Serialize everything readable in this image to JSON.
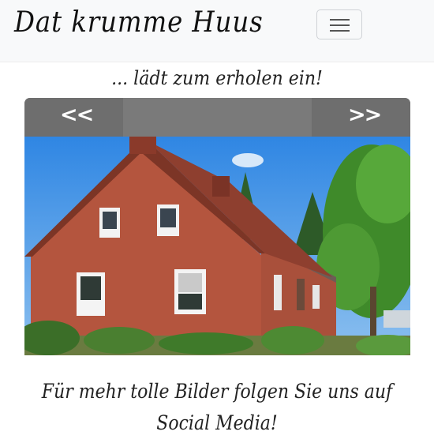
{
  "navbar": {
    "brand": "Dat krumme Huus",
    "toggler_icon": "hamburger-menu-icon"
  },
  "tagline": "... lädt zum erholen ein!",
  "carousel": {
    "prev_label": "<<",
    "next_label": ">>",
    "image_subject": "red-brick-house-photo"
  },
  "footer": {
    "line1": "Für mehr tolle Bilder folgen Sie uns auf",
    "line2": "Social Media!"
  },
  "colors": {
    "navbar_bg": "#f8f9fa",
    "carousel_bar": "#7a7a7a",
    "brick": "#b4553e",
    "roof": "#8e3f2f",
    "sky": "#3d8fe0",
    "foliage": "#3f8a2a"
  }
}
